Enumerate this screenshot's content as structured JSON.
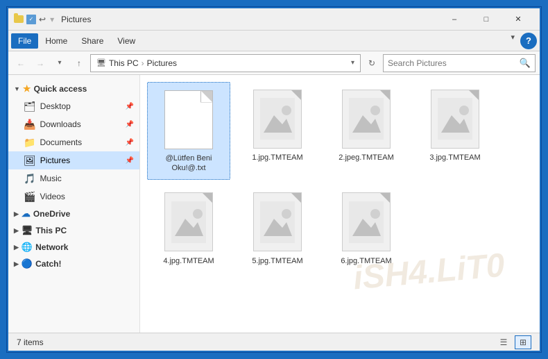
{
  "window": {
    "title": "Pictures",
    "minimize_label": "–",
    "maximize_label": "□",
    "close_label": "✕"
  },
  "menubar": {
    "items": [
      {
        "label": "File",
        "active": true
      },
      {
        "label": "Home"
      },
      {
        "label": "Share"
      },
      {
        "label": "View"
      }
    ],
    "help_label": "?"
  },
  "addressbar": {
    "back_label": "←",
    "forward_label": "→",
    "up_label": "↑",
    "path": [
      "This PC",
      "Pictures"
    ],
    "refresh_label": "↻",
    "search_placeholder": "Search Pictures",
    "dropdown_label": "▾"
  },
  "sidebar": {
    "quick_access_label": "Quick access",
    "items_quick": [
      {
        "label": "Desktop",
        "pinned": true
      },
      {
        "label": "Downloads",
        "pinned": true
      },
      {
        "label": "Documents",
        "pinned": true
      },
      {
        "label": "Pictures",
        "pinned": true,
        "active": true
      }
    ],
    "items_extra": [
      {
        "label": "Music"
      },
      {
        "label": "Videos"
      }
    ],
    "onedrive_label": "OneDrive",
    "thispc_label": "This PC",
    "network_label": "Network",
    "catch_label": "Catch!"
  },
  "files": [
    {
      "name": "@Lütfen Beni\nOku!@.txt",
      "type": "txt",
      "selected": true
    },
    {
      "name": "1.jpg.TMTEAM",
      "type": "img"
    },
    {
      "name": "2.jpeg.TMTEAM",
      "type": "img"
    },
    {
      "name": "3.jpg.TMTEAM",
      "type": "img"
    },
    {
      "name": "4.jpg.TMTEAM",
      "type": "img"
    },
    {
      "name": "5.jpg.TMTEAM",
      "type": "img"
    },
    {
      "name": "6.jpg.TMTEAM",
      "type": "img"
    }
  ],
  "statusbar": {
    "item_count": "7 items",
    "view_list_label": "☰",
    "view_details_label": "≡",
    "view_large_label": "⊞"
  }
}
